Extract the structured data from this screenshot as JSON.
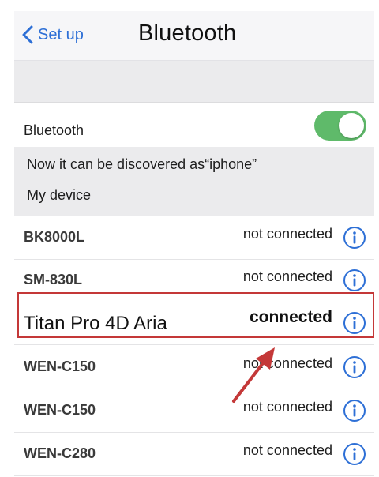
{
  "nav": {
    "back_label": "Set up",
    "title": "Bluetooth"
  },
  "bluetooth": {
    "label": "Bluetooth",
    "enabled": true,
    "toggle_color": "#5fba6a"
  },
  "discover_text": "Now it can be discovered as“iphone”",
  "section_title": "My device",
  "devices": [
    {
      "name": "BK8000L",
      "status": "not connected"
    },
    {
      "name": "SM-830L",
      "status": "not connected"
    },
    {
      "name": "Titan Pro 4D Aria",
      "status": "connected"
    },
    {
      "name": "WEN-C150",
      "status": "not connected"
    },
    {
      "name": "WEN-C150",
      "status": "not connected"
    },
    {
      "name": "WEN-C280",
      "status": "not connected"
    }
  ],
  "colors": {
    "accent": "#2d6fd6",
    "highlight": "#c43838"
  }
}
